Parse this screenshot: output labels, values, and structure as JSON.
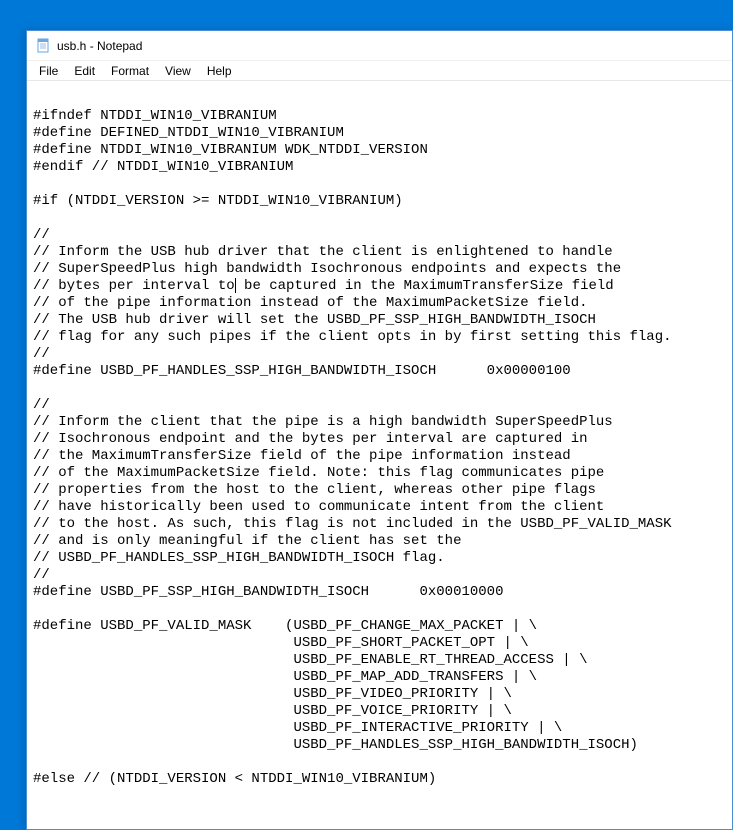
{
  "window": {
    "title": "usb.h - Notepad"
  },
  "menubar": {
    "items": [
      "File",
      "Edit",
      "Format",
      "View",
      "Help"
    ]
  },
  "editor": {
    "lines": [
      "",
      "#ifndef NTDDI_WIN10_VIBRANIUM",
      "#define DEFINED_NTDDI_WIN10_VIBRANIUM",
      "#define NTDDI_WIN10_VIBRANIUM WDK_NTDDI_VERSION",
      "#endif // NTDDI_WIN10_VIBRANIUM",
      "",
      "#if (NTDDI_VERSION >= NTDDI_WIN10_VIBRANIUM)",
      "",
      "//",
      "// Inform the USB hub driver that the client is enlightened to handle",
      "// SuperSpeedPlus high bandwidth Isochronous endpoints and expects the",
      "// bytes per interval to| be captured in the MaximumTransferSize field",
      "// of the pipe information instead of the MaximumPacketSize field.",
      "// The USB hub driver will set the USBD_PF_SSP_HIGH_BANDWIDTH_ISOCH",
      "// flag for any such pipes if the client opts in by first setting this flag.",
      "//",
      "#define USBD_PF_HANDLES_SSP_HIGH_BANDWIDTH_ISOCH      0x00000100",
      "",
      "//",
      "// Inform the client that the pipe is a high bandwidth SuperSpeedPlus",
      "// Isochronous endpoint and the bytes per interval are captured in",
      "// the MaximumTransferSize field of the pipe information instead",
      "// of the MaximumPacketSize field. Note: this flag communicates pipe",
      "// properties from the host to the client, whereas other pipe flags",
      "// have historically been used to communicate intent from the client",
      "// to the host. As such, this flag is not included in the USBD_PF_VALID_MASK",
      "// and is only meaningful if the client has set the",
      "// USBD_PF_HANDLES_SSP_HIGH_BANDWIDTH_ISOCH flag.",
      "//",
      "#define USBD_PF_SSP_HIGH_BANDWIDTH_ISOCH      0x00010000",
      "",
      "#define USBD_PF_VALID_MASK    (USBD_PF_CHANGE_MAX_PACKET | \\",
      "                               USBD_PF_SHORT_PACKET_OPT | \\",
      "                               USBD_PF_ENABLE_RT_THREAD_ACCESS | \\",
      "                               USBD_PF_MAP_ADD_TRANSFERS | \\",
      "                               USBD_PF_VIDEO_PRIORITY | \\",
      "                               USBD_PF_VOICE_PRIORITY | \\",
      "                               USBD_PF_INTERACTIVE_PRIORITY | \\",
      "                               USBD_PF_HANDLES_SSP_HIGH_BANDWIDTH_ISOCH)",
      "",
      "#else // (NTDDI_VERSION < NTDDI_WIN10_VIBRANIUM)"
    ],
    "caret_line": 11,
    "caret_col": 24
  }
}
